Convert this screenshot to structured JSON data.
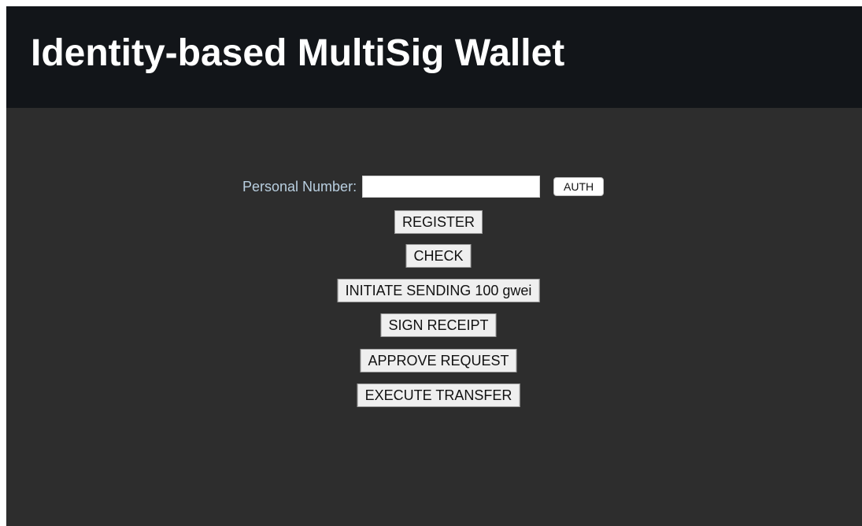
{
  "header": {
    "title": "Identity-based MultiSig Wallet"
  },
  "auth": {
    "label": "Personal Number:",
    "input_value": "",
    "input_placeholder": "",
    "button_label": "AUTH"
  },
  "actions": {
    "register": "REGISTER",
    "check": "CHECK",
    "initiate": "INITIATE SENDING 100 gwei",
    "sign": "SIGN RECEIPT",
    "approve": "APPROVE REQUEST",
    "execute": "EXECUTE TRANSFER"
  },
  "colors": {
    "header_bg": "#121519",
    "page_bg": "#2d2d2d",
    "label_text": "#b9cfe0",
    "button_bg": "#efefef"
  }
}
